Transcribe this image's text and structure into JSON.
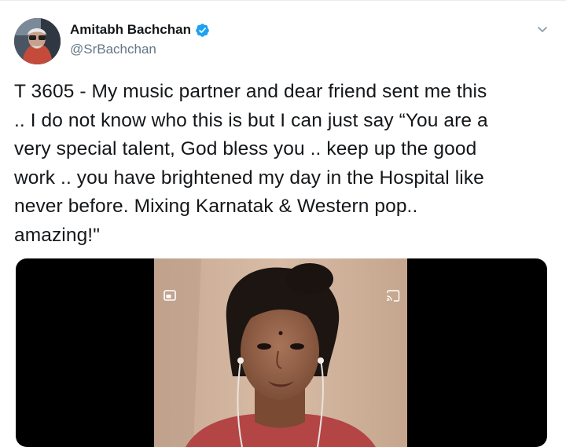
{
  "tweet": {
    "author": {
      "display_name": "Amitabh Bachchan",
      "handle": "@SrBachchan",
      "verified": true
    },
    "text": "T 3605 - My music partner and dear friend sent me this\n.. I do not know who this is but I can just say “You are a\nvery special talent, God bless you .. keep up the good\nwork .. you have brightened my day in the Hospital like\nnever before. Mixing Karnatak & Western pop..\namazing!\"",
    "media": {
      "type": "video",
      "controls": [
        "picture-in-picture-icon",
        "cast-icon"
      ]
    },
    "menu_icon": "chevron-down-icon"
  },
  "colors": {
    "text_primary": "#14171a",
    "text_secondary": "#657786",
    "verified_blue": "#1da1f2",
    "media_background": "#000000"
  }
}
